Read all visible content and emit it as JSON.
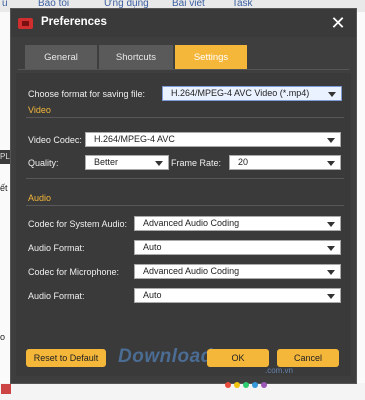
{
  "background": {
    "top_links": [
      "u",
      "Bảo tồi",
      "Ứng dụng",
      "Bài viết",
      "Task"
    ],
    "side_left_label": "PL",
    "side_left_text": "ết",
    "side_bottom_text": "o"
  },
  "dialog": {
    "title": "Preferences",
    "close_glyph": "✕",
    "tabs": [
      {
        "label": "General",
        "active": false
      },
      {
        "label": "Shortcuts",
        "active": false
      },
      {
        "label": "Settings",
        "active": true
      }
    ],
    "format": {
      "label": "Choose format for saving file:",
      "value": "H.264/MPEG-4 AVC Video (*.mp4)"
    },
    "video": {
      "section": "Video",
      "codec_label": "Video Codec:",
      "codec_value": "H.264/MPEG-4 AVC",
      "quality_label": "Quality:",
      "quality_value": "Better",
      "framerate_label": "Frame Rate:",
      "framerate_value": "20"
    },
    "audio": {
      "section": "Audio",
      "system_codec_label": "Codec for System Audio:",
      "system_codec_value": "Advanced Audio Coding",
      "system_format_label": "Audio Format:",
      "system_format_value": "Auto",
      "mic_codec_label": "Codec for Microphone:",
      "mic_codec_value": "Advanced Audio Coding",
      "mic_format_label": "Audio Format:",
      "mic_format_value": "Auto"
    },
    "buttons": {
      "reset": "Reset to Default",
      "ok": "OK",
      "cancel": "Cancel"
    }
  },
  "watermark": {
    "text": "Download",
    "sub": ".com.vn"
  },
  "colors": {
    "accent": "#f5b73a",
    "dialog_bg": "#3e3e3e",
    "section": "#f5b73a"
  },
  "dots": [
    "#e74c3c",
    "#f1c40f",
    "#2ecc71",
    "#3498db",
    "#9b59b6"
  ]
}
